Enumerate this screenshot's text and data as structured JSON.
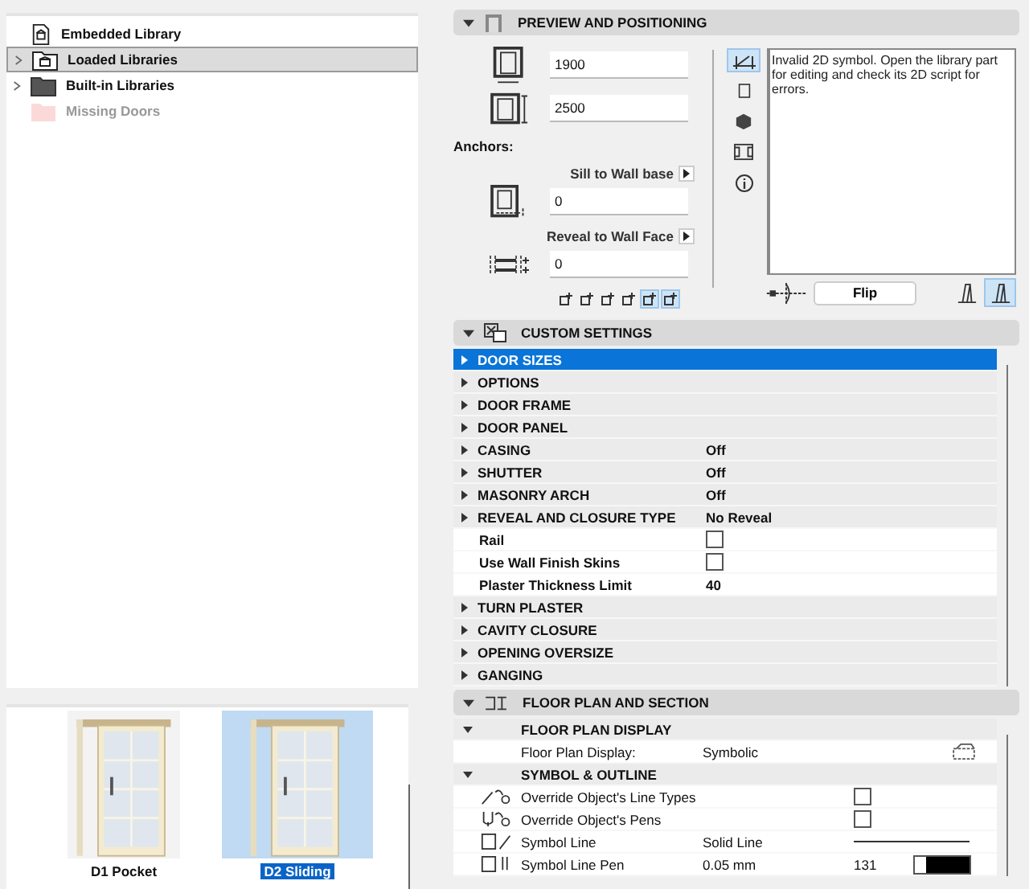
{
  "library_tree": [
    {
      "label": "Embedded Library",
      "kind": "embedded",
      "has_children": false,
      "selected": false
    },
    {
      "label": "Loaded Libraries",
      "kind": "loaded",
      "has_children": true,
      "selected": true
    },
    {
      "label": "Built-in Libraries",
      "kind": "builtin",
      "has_children": true,
      "selected": false
    },
    {
      "label": "Missing Doors",
      "kind": "missing",
      "has_children": false,
      "selected": false
    }
  ],
  "thumbnails": [
    {
      "label": "D1 Pocket",
      "selected": false
    },
    {
      "label": "D2 Sliding",
      "selected": true
    }
  ],
  "preview": {
    "title": "PREVIEW AND POSITIONING",
    "width_value": "1900",
    "height_value": "2500",
    "anchors_label": "Anchors:",
    "sill_label": "Sill to Wall base",
    "sill_value": "0",
    "reveal_label": "Reveal to Wall Face",
    "reveal_value": "0",
    "anchor_buttons": [
      {
        "selected": false
      },
      {
        "selected": false
      },
      {
        "selected": false
      },
      {
        "selected": false
      },
      {
        "selected": true
      },
      {
        "selected": true
      }
    ],
    "view_tabs": [
      {
        "selected": true
      },
      {
        "selected": false
      },
      {
        "selected": false
      },
      {
        "selected": false
      },
      {
        "selected": false
      }
    ],
    "message": "Invalid 2D symbol. Open the library part for editing and check its 2D script for errors.",
    "flip_button": "Flip",
    "side_toggles": [
      {
        "selected": false
      },
      {
        "selected": true
      }
    ]
  },
  "custom_settings": {
    "title": "CUSTOM SETTINGS",
    "rows": [
      {
        "kind": "group",
        "label": "DOOR SIZES",
        "selected": true
      },
      {
        "kind": "group",
        "label": "OPTIONS",
        "selected": false
      },
      {
        "kind": "group",
        "label": "DOOR FRAME",
        "selected": false
      },
      {
        "kind": "group",
        "label": "DOOR PANEL",
        "selected": false
      },
      {
        "kind": "group",
        "label": "CASING",
        "value": "Off",
        "selected": false
      },
      {
        "kind": "group",
        "label": "SHUTTER",
        "value": "Off",
        "selected": false
      },
      {
        "kind": "group",
        "label": "MASONRY ARCH",
        "value": "Off",
        "selected": false
      },
      {
        "kind": "group",
        "label": "REVEAL AND CLOSURE TYPE",
        "value": "No Reveal",
        "selected": false
      },
      {
        "kind": "checkbox",
        "label": "Rail",
        "checked": false,
        "selected": false
      },
      {
        "kind": "checkbox",
        "label": "Use Wall Finish Skins",
        "checked": false,
        "selected": false
      },
      {
        "kind": "value",
        "label": "Plaster Thickness Limit",
        "value": "40",
        "selected": false
      },
      {
        "kind": "group",
        "label": "TURN PLASTER",
        "selected": false
      },
      {
        "kind": "group",
        "label": "CAVITY CLOSURE",
        "selected": false
      },
      {
        "kind": "group",
        "label": "OPENING OVERSIZE",
        "selected": false
      },
      {
        "kind": "group",
        "label": "GANGING",
        "selected": false
      }
    ]
  },
  "floor_plan": {
    "title": "FLOOR PLAN AND SECTION",
    "rows": [
      {
        "kind": "subgroup",
        "label": "FLOOR PLAN DISPLAY"
      },
      {
        "kind": "display",
        "label": "Floor Plan Display:",
        "value": "Symbolic"
      },
      {
        "kind": "subgroup",
        "label": "SYMBOL & OUTLINE"
      },
      {
        "kind": "checkbox",
        "label": "Override Object's Line Types",
        "checked": false
      },
      {
        "kind": "checkbox",
        "label": "Override Object's Pens",
        "checked": false
      },
      {
        "kind": "line",
        "label": "Symbol Line",
        "value": "Solid Line"
      },
      {
        "kind": "pen",
        "label": "Symbol Line Pen",
        "value": "0.05 mm",
        "number": "131"
      }
    ]
  }
}
